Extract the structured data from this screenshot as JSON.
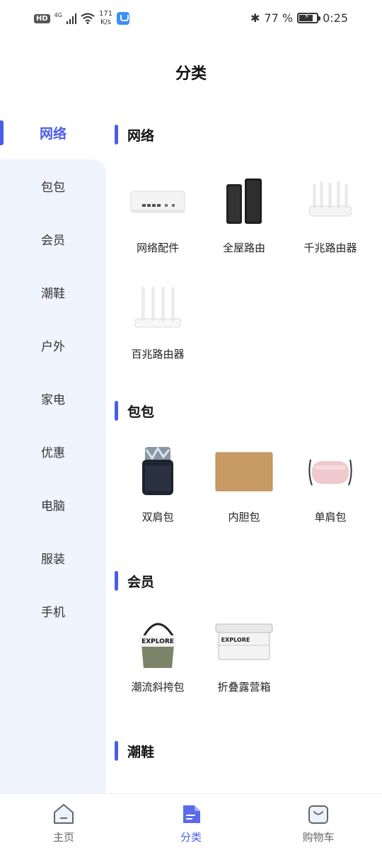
{
  "status_bar": {
    "hd": "HD",
    "network": "4G",
    "speed_value": "171",
    "speed_unit": "K/s",
    "battery_percent": "77 %",
    "battery_level": 0.77,
    "time": "0:25"
  },
  "header": {
    "title": "分类"
  },
  "sidebar": {
    "items": [
      {
        "label": "网络",
        "active": true
      },
      {
        "label": "包包"
      },
      {
        "label": "会员"
      },
      {
        "label": "潮鞋"
      },
      {
        "label": "户外"
      },
      {
        "label": "家电"
      },
      {
        "label": "优惠"
      },
      {
        "label": "电脑"
      },
      {
        "label": "服装"
      },
      {
        "label": "手机"
      }
    ]
  },
  "sections": [
    {
      "title": "网络",
      "products": [
        {
          "label": "网络配件",
          "icon": "network-switch-image"
        },
        {
          "label": "全屋路由",
          "icon": "mesh-router-image"
        },
        {
          "label": "千兆路由器",
          "icon": "gigabit-router-image"
        },
        {
          "label": "百兆路由器",
          "icon": "fast-router-image"
        }
      ]
    },
    {
      "title": "包包",
      "products": [
        {
          "label": "双肩包",
          "icon": "backpack-image"
        },
        {
          "label": "内胆包",
          "icon": "laptop-sleeve-image"
        },
        {
          "label": "单肩包",
          "icon": "shoulder-bag-image"
        }
      ]
    },
    {
      "title": "会员",
      "products": [
        {
          "label": "潮流斜挎包",
          "icon": "crossbody-bag-image",
          "brand": "EXPLORE"
        },
        {
          "label": "折叠露营箱",
          "icon": "camping-box-image",
          "brand": "EXPLORE"
        }
      ]
    },
    {
      "title": "潮鞋",
      "products": []
    }
  ],
  "bottom_nav": {
    "items": [
      {
        "label": "主页",
        "icon": "home-icon"
      },
      {
        "label": "分类",
        "icon": "category-icon",
        "active": true
      },
      {
        "label": "购物车",
        "icon": "cart-icon"
      }
    ]
  },
  "colors": {
    "accent": "#4a5de8",
    "sidebar_bg": "#f0f4ff"
  }
}
